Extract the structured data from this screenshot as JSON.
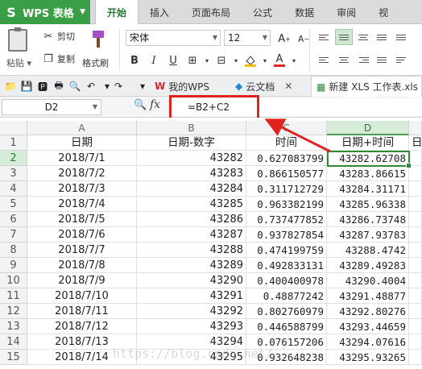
{
  "app": {
    "name": "WPS 表格"
  },
  "menu": {
    "tabs": [
      "开始",
      "插入",
      "页面布局",
      "公式",
      "数据",
      "审阅",
      "视"
    ]
  },
  "ribbon": {
    "paste_label": "粘贴",
    "cut_label": "剪切",
    "copy_label": "复制",
    "format_painter_label": "格式刷",
    "font_name": "宋体",
    "font_size": "12"
  },
  "documents": {
    "tabs": [
      {
        "label": "我的WPS",
        "active": false
      },
      {
        "label": "云文档",
        "active": false
      },
      {
        "label": "新建 XLS 工作表.xls",
        "active": true
      }
    ]
  },
  "formula_bar": {
    "cell_ref": "D2",
    "fx_label": "fx",
    "formula": "=B2+C2"
  },
  "sheet": {
    "columns": [
      "A",
      "B",
      "C",
      "D"
    ],
    "headers": [
      "日期",
      "日期-数字",
      "时间",
      "日期+时间",
      "日"
    ],
    "rows": [
      {
        "n": "2",
        "a": "2018/7/1",
        "b": "43282",
        "c": "0.627083799",
        "d": "43282.62708"
      },
      {
        "n": "3",
        "a": "2018/7/2",
        "b": "43283",
        "c": "0.866150577",
        "d": "43283.86615"
      },
      {
        "n": "4",
        "a": "2018/7/3",
        "b": "43284",
        "c": "0.311712729",
        "d": "43284.31171"
      },
      {
        "n": "5",
        "a": "2018/7/4",
        "b": "43285",
        "c": "0.963382199",
        "d": "43285.96338"
      },
      {
        "n": "6",
        "a": "2018/7/5",
        "b": "43286",
        "c": "0.737477852",
        "d": "43286.73748"
      },
      {
        "n": "7",
        "a": "2018/7/6",
        "b": "43287",
        "c": "0.937827854",
        "d": "43287.93783"
      },
      {
        "n": "8",
        "a": "2018/7/7",
        "b": "43288",
        "c": "0.474199759",
        "d": "43288.4742"
      },
      {
        "n": "9",
        "a": "2018/7/8",
        "b": "43289",
        "c": "0.492833131",
        "d": "43289.49283"
      },
      {
        "n": "10",
        "a": "2018/7/9",
        "b": "43290",
        "c": "0.400400978",
        "d": "43290.4004"
      },
      {
        "n": "11",
        "a": "2018/7/10",
        "b": "43291",
        "c": "0.48877242",
        "d": "43291.48877"
      },
      {
        "n": "12",
        "a": "2018/7/11",
        "b": "43292",
        "c": "0.802760979",
        "d": "43292.80276"
      },
      {
        "n": "13",
        "a": "2018/7/12",
        "b": "43293",
        "c": "0.446588799",
        "d": "43293.44659"
      },
      {
        "n": "14",
        "a": "2018/7/13",
        "b": "43294",
        "c": "0.076157206",
        "d": "43294.07616"
      },
      {
        "n": "15",
        "a": "2018/7/14",
        "b": "43295",
        "c": "0.932648238",
        "d": "43295.93265"
      }
    ]
  },
  "watermark": "https://blog.csdn.net/...",
  "colors": {
    "brand_green": "#3a9e47",
    "highlight_red": "#e0231d"
  }
}
